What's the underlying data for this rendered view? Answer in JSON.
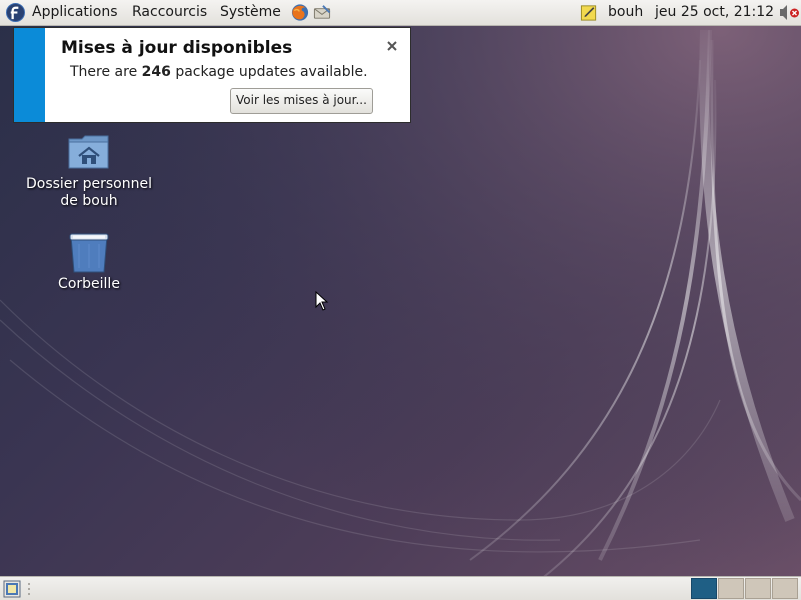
{
  "top_panel": {
    "menus": {
      "applications": "Applications",
      "places": "Raccourcis",
      "system": "Système"
    },
    "user": "bouh",
    "clock": "jeu 25 oct, 21:12"
  },
  "notification": {
    "title": "Mises à jour disponibles",
    "body_prefix": "There are ",
    "count": "246",
    "body_suffix": " package updates available.",
    "action_label": "Voir les mises à jour...",
    "accent_color": "#0b8bd8"
  },
  "desktop": {
    "icons": [
      {
        "label_line1": "Dossier personnel",
        "label_line2": "de bouh",
        "icon": "home-folder-icon"
      },
      {
        "label": "Corbeille",
        "icon": "trash-icon"
      }
    ]
  },
  "bottom_panel": {
    "workspace_count": "4",
    "active_workspace": "1",
    "active_color": "#1f5f85"
  }
}
